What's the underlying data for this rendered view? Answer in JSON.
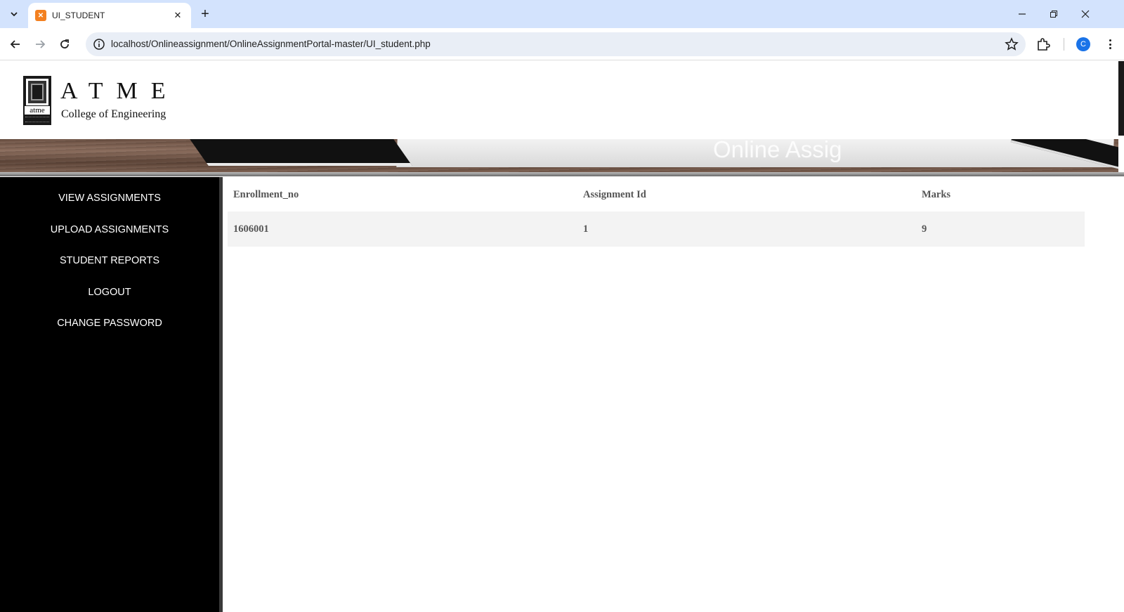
{
  "browser": {
    "tab_title": "UI_STUDENT",
    "tab_favicon_icon": "xampp-icon",
    "url": "localhost/Onlineassignment/OnlineAssignmentPortal-master/UI_student.php",
    "profile_initial": "C"
  },
  "header": {
    "logo_word": "ATME",
    "logo_emblem_word": "atme",
    "logo_subtitle": "College of Engineering",
    "banner_title": "Online Assig"
  },
  "sidebar": {
    "items": [
      {
        "label": "VIEW ASSIGNMENTS"
      },
      {
        "label": "UPLOAD ASSIGNMENTS"
      },
      {
        "label": "STUDENT REPORTS"
      },
      {
        "label": "LOGOUT"
      },
      {
        "label": "CHANGE PASSWORD"
      }
    ]
  },
  "report": {
    "columns": [
      "Enrollment_no",
      "Assignment Id",
      "Marks"
    ],
    "rows": [
      [
        "1606001",
        "1",
        "9"
      ]
    ]
  },
  "colors": {
    "sidebar_bg": "#000000",
    "chrome_tabbar": "#d3e3fd",
    "row_bg": "#f3f3f3",
    "table_text": "#555555"
  }
}
